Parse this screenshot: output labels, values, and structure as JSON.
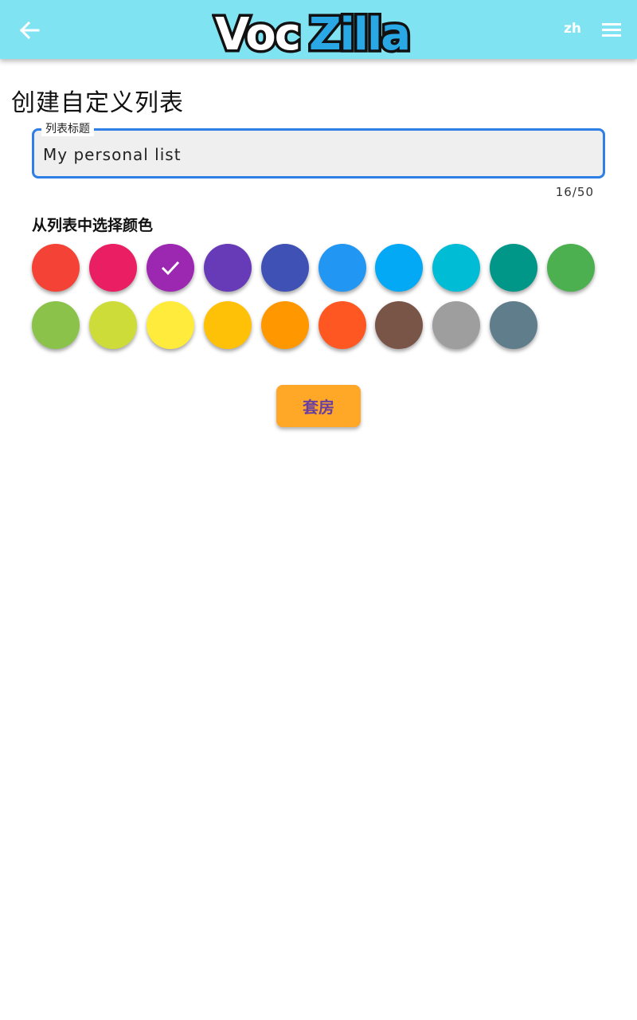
{
  "appbar": {
    "logo_text": "VocZilla",
    "language": "zh",
    "back_icon": "arrow-back-icon",
    "menu_icon": "hamburger-menu-icon",
    "background": "#80e3f1"
  },
  "page": {
    "title": "创建自定义列表"
  },
  "title_field": {
    "label": "列表标题",
    "value": "My personal list",
    "counter": "16/50"
  },
  "color_section": {
    "title": "从列表中选择颜色",
    "selected_index": 2,
    "check_icon": "checkmark-icon",
    "colors": [
      "#f44336",
      "#e91e63",
      "#9c27b0",
      "#673ab7",
      "#3f51b5",
      "#2196f3",
      "#03a9f4",
      "#00bcd4",
      "#009688",
      "#4caf50",
      "#8bc34a",
      "#cddc39",
      "#ffeb3b",
      "#ffc107",
      "#ff9800",
      "#ff5722",
      "#795548",
      "#9e9e9e",
      "#607d8b"
    ]
  },
  "actions": {
    "save_label": "套房",
    "save_color": "#ffa726"
  }
}
